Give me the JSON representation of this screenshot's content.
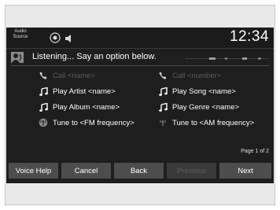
{
  "status": {
    "audio_source_label": "Audio Source",
    "time": "12:34"
  },
  "header": {
    "listening_text": "Listening... Say an option below."
  },
  "commands": [
    {
      "label": "Call <name>",
      "icon": "phone-icon",
      "enabled": false
    },
    {
      "label": "Call <number>",
      "icon": "phone-icon",
      "enabled": false
    },
    {
      "label": "Play Artist <name>",
      "icon": "music-note-icon",
      "enabled": true
    },
    {
      "label": "Play Song <name>",
      "icon": "music-note-icon",
      "enabled": true
    },
    {
      "label": "Play Album <name>",
      "icon": "music-note-icon",
      "enabled": true
    },
    {
      "label": "Play Genre <name>",
      "icon": "music-note-icon",
      "enabled": true
    },
    {
      "label": "Tune to <FM frequency>",
      "icon": "radio-icon",
      "enabled": true
    },
    {
      "label": "Tune to <AM frequency>",
      "icon": "radio-icon",
      "enabled": true
    }
  ],
  "pagination": {
    "text": "Page 1 of 2"
  },
  "buttons": [
    {
      "label": "Voice Help",
      "enabled": true
    },
    {
      "label": "Cancel",
      "enabled": true
    },
    {
      "label": "Back",
      "enabled": true
    },
    {
      "label": "Previous",
      "enabled": false
    },
    {
      "label": "Next",
      "enabled": true
    }
  ],
  "colors": {
    "background": "#1e1e1e",
    "text": "#ffffff",
    "disabled_text": "#5b5b5b",
    "button": "#4d4d4d"
  }
}
